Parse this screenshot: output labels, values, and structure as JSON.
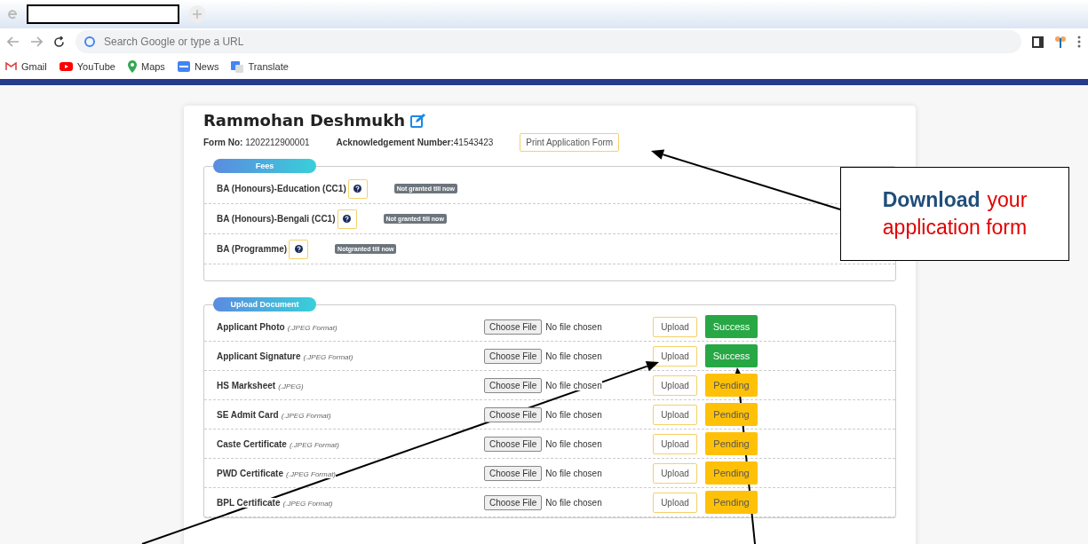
{
  "browser": {
    "address_placeholder": "Search Google or type a URL",
    "bookmarks": [
      {
        "label": "Gmail",
        "kind": "gmail"
      },
      {
        "label": "YouTube",
        "kind": "youtube"
      },
      {
        "label": "Maps",
        "kind": "maps"
      },
      {
        "label": "News",
        "kind": "news"
      },
      {
        "label": "Translate",
        "kind": "translate"
      }
    ]
  },
  "applicant": {
    "name": "Rammohan Deshmukh",
    "form_no_label": "Form No:",
    "form_no": "1202212900001",
    "ack_label": "Acknowledgement Number:",
    "ack_number": "41543423",
    "print_button": "Print Application Form"
  },
  "fees": {
    "title": "Fees",
    "rows": [
      {
        "course": "BA (Honours)-Education (CC1)",
        "status": "Not granted till now"
      },
      {
        "course": "BA (Honours)-Bengali (CC1)",
        "status": "Not granted till now"
      },
      {
        "course": "BA (Programme)",
        "status": "Notgranted till now"
      }
    ]
  },
  "upload": {
    "title": "Upload Document",
    "rows": [
      {
        "name": "Applicant Photo",
        "format": "(.JPEG Format)",
        "choose": "Choose File",
        "file": "No file chosen",
        "upload": "Upload",
        "status": "Success",
        "kind": "success"
      },
      {
        "name": "Applicant Signature",
        "format": "(.JPEG Format)",
        "choose": "Choose File",
        "file": "No file chosen",
        "upload": "Upload",
        "status": "Success",
        "kind": "success"
      },
      {
        "name": "HS Marksheet",
        "format": "(.JPEG)",
        "choose": "Choose File",
        "file": "No file chosen",
        "upload": "Upload",
        "status": "Pending",
        "kind": "pending"
      },
      {
        "name": "SE Admit Card",
        "format": "(.JPEG Format)",
        "choose": "Choose File",
        "file": "No file chosen",
        "upload": "Upload",
        "status": "Pending",
        "kind": "pending"
      },
      {
        "name": "Caste Certificate",
        "format": "(.JPEG Format)",
        "choose": "Choose File",
        "file": "No file chosen",
        "upload": "Upload",
        "status": "Pending",
        "kind": "pending"
      },
      {
        "name": "PWD Certificate",
        "format": "(.JPEG Format)",
        "choose": "Choose File",
        "file": "No file chosen",
        "upload": "Upload",
        "status": "Pending",
        "kind": "pending"
      },
      {
        "name": "BPL Certificate",
        "format": "(.JPEG Format)",
        "choose": "Choose File",
        "file": "No file chosen",
        "upload": "Upload",
        "status": "Pending",
        "kind": "pending"
      }
    ]
  },
  "callout": {
    "parts": [
      {
        "text": "Download",
        "color": "#1f4e79"
      },
      {
        "text": "your",
        "color": "#e00000"
      },
      {
        "text": "application form",
        "color": "#e00000"
      }
    ]
  }
}
